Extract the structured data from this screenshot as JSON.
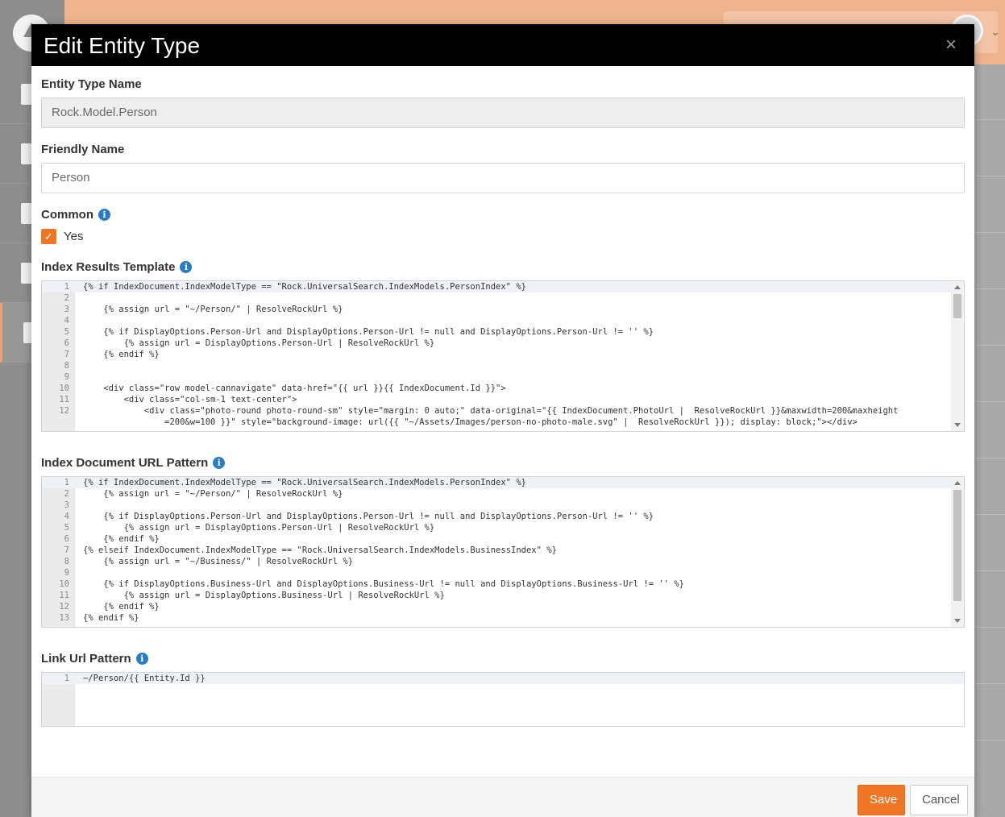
{
  "modal": {
    "title": "Edit Entity Type",
    "close": "×"
  },
  "fields": {
    "entity_type_name": {
      "label": "Entity Type Name",
      "value": "Rock.Model.Person"
    },
    "friendly_name": {
      "label": "Friendly Name",
      "value": "Person"
    },
    "common": {
      "label": "Common",
      "option": "Yes",
      "checked": true
    },
    "index_results_template": {
      "label": "Index Results Template",
      "lines": [
        "{% if IndexDocument.IndexModelType == \"Rock.UniversalSearch.IndexModels.PersonIndex\" %}",
        "",
        "    {% assign url = \"~/Person/\" | ResolveRockUrl %}",
        "",
        "    {% if DisplayOptions.Person-Url and DisplayOptions.Person-Url != null and DisplayOptions.Person-Url != '' %}",
        "        {% assign url = DisplayOptions.Person-Url | ResolveRockUrl %}",
        "    {% endif %}",
        "",
        "",
        "    <div class=\"row model-cannavigate\" data-href=\"{{ url }}{{ IndexDocument.Id }}\">",
        "        <div class=\"col-sm-1 text-center\">",
        "            <div class=\"photo-round photo-round-sm\" style=\"margin: 0 auto;\" data-original=\"{{ IndexDocument.PhotoUrl |  ResolveRockUrl }}&maxwidth=200&maxheight",
        "                =200&w=100 }}\" style=\"background-image: url({{ \"~/Assets/Images/person-no-photo-male.svg\" |  ResolveRockUrl }}); display: block;\"></div>"
      ],
      "line_numbers": [
        "1",
        "2",
        "3",
        "4",
        "5",
        "6",
        "7",
        "8",
        "9",
        "10",
        "11",
        "12",
        ""
      ]
    },
    "index_document_url_pattern": {
      "label": "Index Document URL Pattern",
      "lines": [
        "{% if IndexDocument.IndexModelType == \"Rock.UniversalSearch.IndexModels.PersonIndex\" %}",
        "    {% assign url = \"~/Person/\" | ResolveRockUrl %}",
        "",
        "    {% if DisplayOptions.Person-Url and DisplayOptions.Person-Url != null and DisplayOptions.Person-Url != '' %}",
        "        {% assign url = DisplayOptions.Person-Url | ResolveRockUrl %}",
        "    {% endif %}",
        "{% elseif IndexDocument.IndexModelType == \"Rock.UniversalSearch.IndexModels.BusinessIndex\" %}",
        "    {% assign url = \"~/Business/\" | ResolveRockUrl %}",
        "",
        "    {% if DisplayOptions.Business-Url and DisplayOptions.Business-Url != null and DisplayOptions.Business-Url != '' %}",
        "        {% assign url = DisplayOptions.Business-Url | ResolveRockUrl %}",
        "    {% endif %}",
        "{% endif %}"
      ],
      "line_numbers": [
        "1",
        "2",
        "3",
        "4",
        "5",
        "6",
        "7",
        "8",
        "9",
        "10",
        "11",
        "12",
        "13"
      ]
    },
    "link_url_pattern": {
      "label": "Link Url Pattern",
      "lines": [
        "~/Person/{{ Entity.Id }}"
      ],
      "line_numbers": [
        "1"
      ]
    }
  },
  "footer": {
    "save_label": "Save",
    "cancel_label": "Cancel"
  },
  "colors": {
    "accent": "#ee7625",
    "info": "#2a7bc6",
    "header": "#000000",
    "topbar": "#efb48e"
  }
}
